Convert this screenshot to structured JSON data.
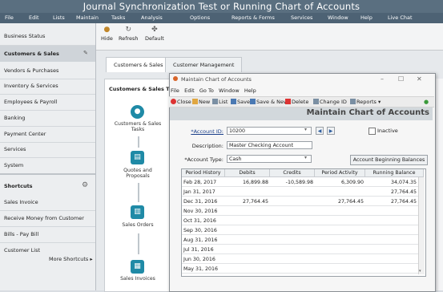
{
  "app": {
    "title": "Journal Synchronization Test or Running Chart of Accounts"
  },
  "menu": [
    "File",
    "Edit",
    "Lists",
    "Maintain",
    "Tasks",
    "Analysis",
    "Options",
    "Reports & Forms",
    "Services",
    "Window",
    "Help",
    "Live Chat"
  ],
  "toolbar": {
    "hide": "Hide",
    "refresh": "Refresh",
    "default": "Default"
  },
  "sidebar": {
    "items": [
      "Business Status",
      "Customers & Sales",
      "Vendors & Purchases",
      "Inventory & Services",
      "Employees & Payroll",
      "Banking",
      "Payment Center",
      "Services",
      "System"
    ],
    "shortcuts_title": "Shortcuts",
    "shortcuts": [
      "Sales Invoice",
      "Receive Money from Customer",
      "Bills - Pay Bill",
      "Customer List"
    ],
    "more_shortcuts": "More Shortcuts ▸"
  },
  "tabs": [
    "Customers & Sales",
    "Customer Management"
  ],
  "flow": {
    "heading": "Customers & Sales Ta",
    "steps": [
      "Customers & Sales Tasks",
      "Quotes and Proposals",
      "Sales Orders",
      "Sales Invoices"
    ]
  },
  "dialog": {
    "title": "Maintain Chart of Accounts",
    "menu": [
      "File",
      "Edit",
      "Go To",
      "Window",
      "Help"
    ],
    "tools": [
      "Close",
      "New",
      "List",
      "Save",
      "Save & New",
      "Delete",
      "Change ID",
      "Reports ▾"
    ],
    "heading": "Maintain Chart of Accounts",
    "account_id_label": "*Account ID:",
    "account_id": "10200",
    "description_label": "Description:",
    "description": "Master Checking Account",
    "account_type_label": "*Account Type:",
    "account_type": "Cash",
    "inactive_label": "Inactive",
    "beginning_balances": "Account Beginning Balances",
    "columns": [
      "Period History",
      "Debits",
      "Credits",
      "Period Activity",
      "Running Balance"
    ],
    "rows": [
      [
        "Feb 28, 2017",
        "16,899.88",
        "-10,589.98",
        "6,309.90",
        "34,074.35"
      ],
      [
        "Jan 31, 2017",
        "",
        "",
        "",
        "27,764.45"
      ],
      [
        "Dec 31, 2016",
        "27,764.45",
        "",
        "27,764.45",
        "27,764.45"
      ],
      [
        "Nov 30, 2016",
        "",
        "",
        "",
        ""
      ],
      [
        "Oct 31, 2016",
        "",
        "",
        "",
        ""
      ],
      [
        "Sep 30, 2016",
        "",
        "",
        "",
        ""
      ],
      [
        "Aug 31, 2016",
        "",
        "",
        "",
        ""
      ],
      [
        "Jul 31, 2016",
        "",
        "",
        "",
        ""
      ],
      [
        "Jun 30, 2016",
        "",
        "",
        "",
        ""
      ],
      [
        "May 31, 2016",
        "",
        "",
        "",
        ""
      ]
    ]
  },
  "colors": {
    "titlebar": "#5a6f80",
    "menubar": "#4d6274",
    "accent": "#2f5e9e"
  }
}
